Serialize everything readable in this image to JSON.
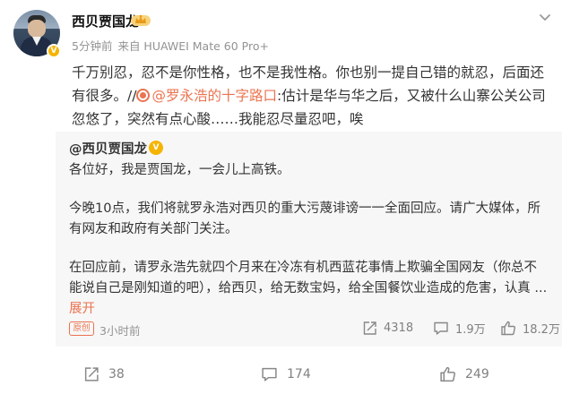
{
  "post": {
    "author": {
      "name": "西贝贾国龙",
      "verified_badge": "V"
    },
    "meta": {
      "time": "5分钟前",
      "source": "来自 HUAWEI Mate 60 Pro+"
    },
    "text_part1": "千万别忍，忍不是你性格，也不是我性格。你也别一提自己错的就忍，后面还有很多。//",
    "mention": "@罗永浩的十字路口",
    "text_part2": ":估计是华与华之后，又被什么山寨公关公司忽悠了，突然有点心酸……我能忍尽量忍吧，唉"
  },
  "repost": {
    "author": "@西贝贾国龙",
    "verified_badge": "V",
    "paragraphs": [
      "各位好，我是贾国龙，一会儿上高铁。",
      "今晚10点，我们将就罗永浩对西贝的重大污蔑诽谤一一全面回应。请广大媒体，所有网友和政府有关部门关注。",
      "在回应前，请罗永浩先就四个月来在冷冻有机西蓝花事情上欺骗全国网友（你总不能说自己是刚知道的吧），给西贝，给无数宝妈，给全国餐饮业造成的危害，认真 ..."
    ],
    "expand_label": "展开",
    "original_tag": "原创",
    "time": "3小时前",
    "stats": {
      "reposts": "4318",
      "comments": "1.9万",
      "likes": "18.2万"
    }
  },
  "footer": {
    "reposts": "38",
    "comments": "174",
    "likes": "249"
  },
  "colors": {
    "accent": "#eb7350",
    "badge": "#f5b400",
    "repost_bg": "#f7f7f7",
    "muted": "#939393"
  }
}
